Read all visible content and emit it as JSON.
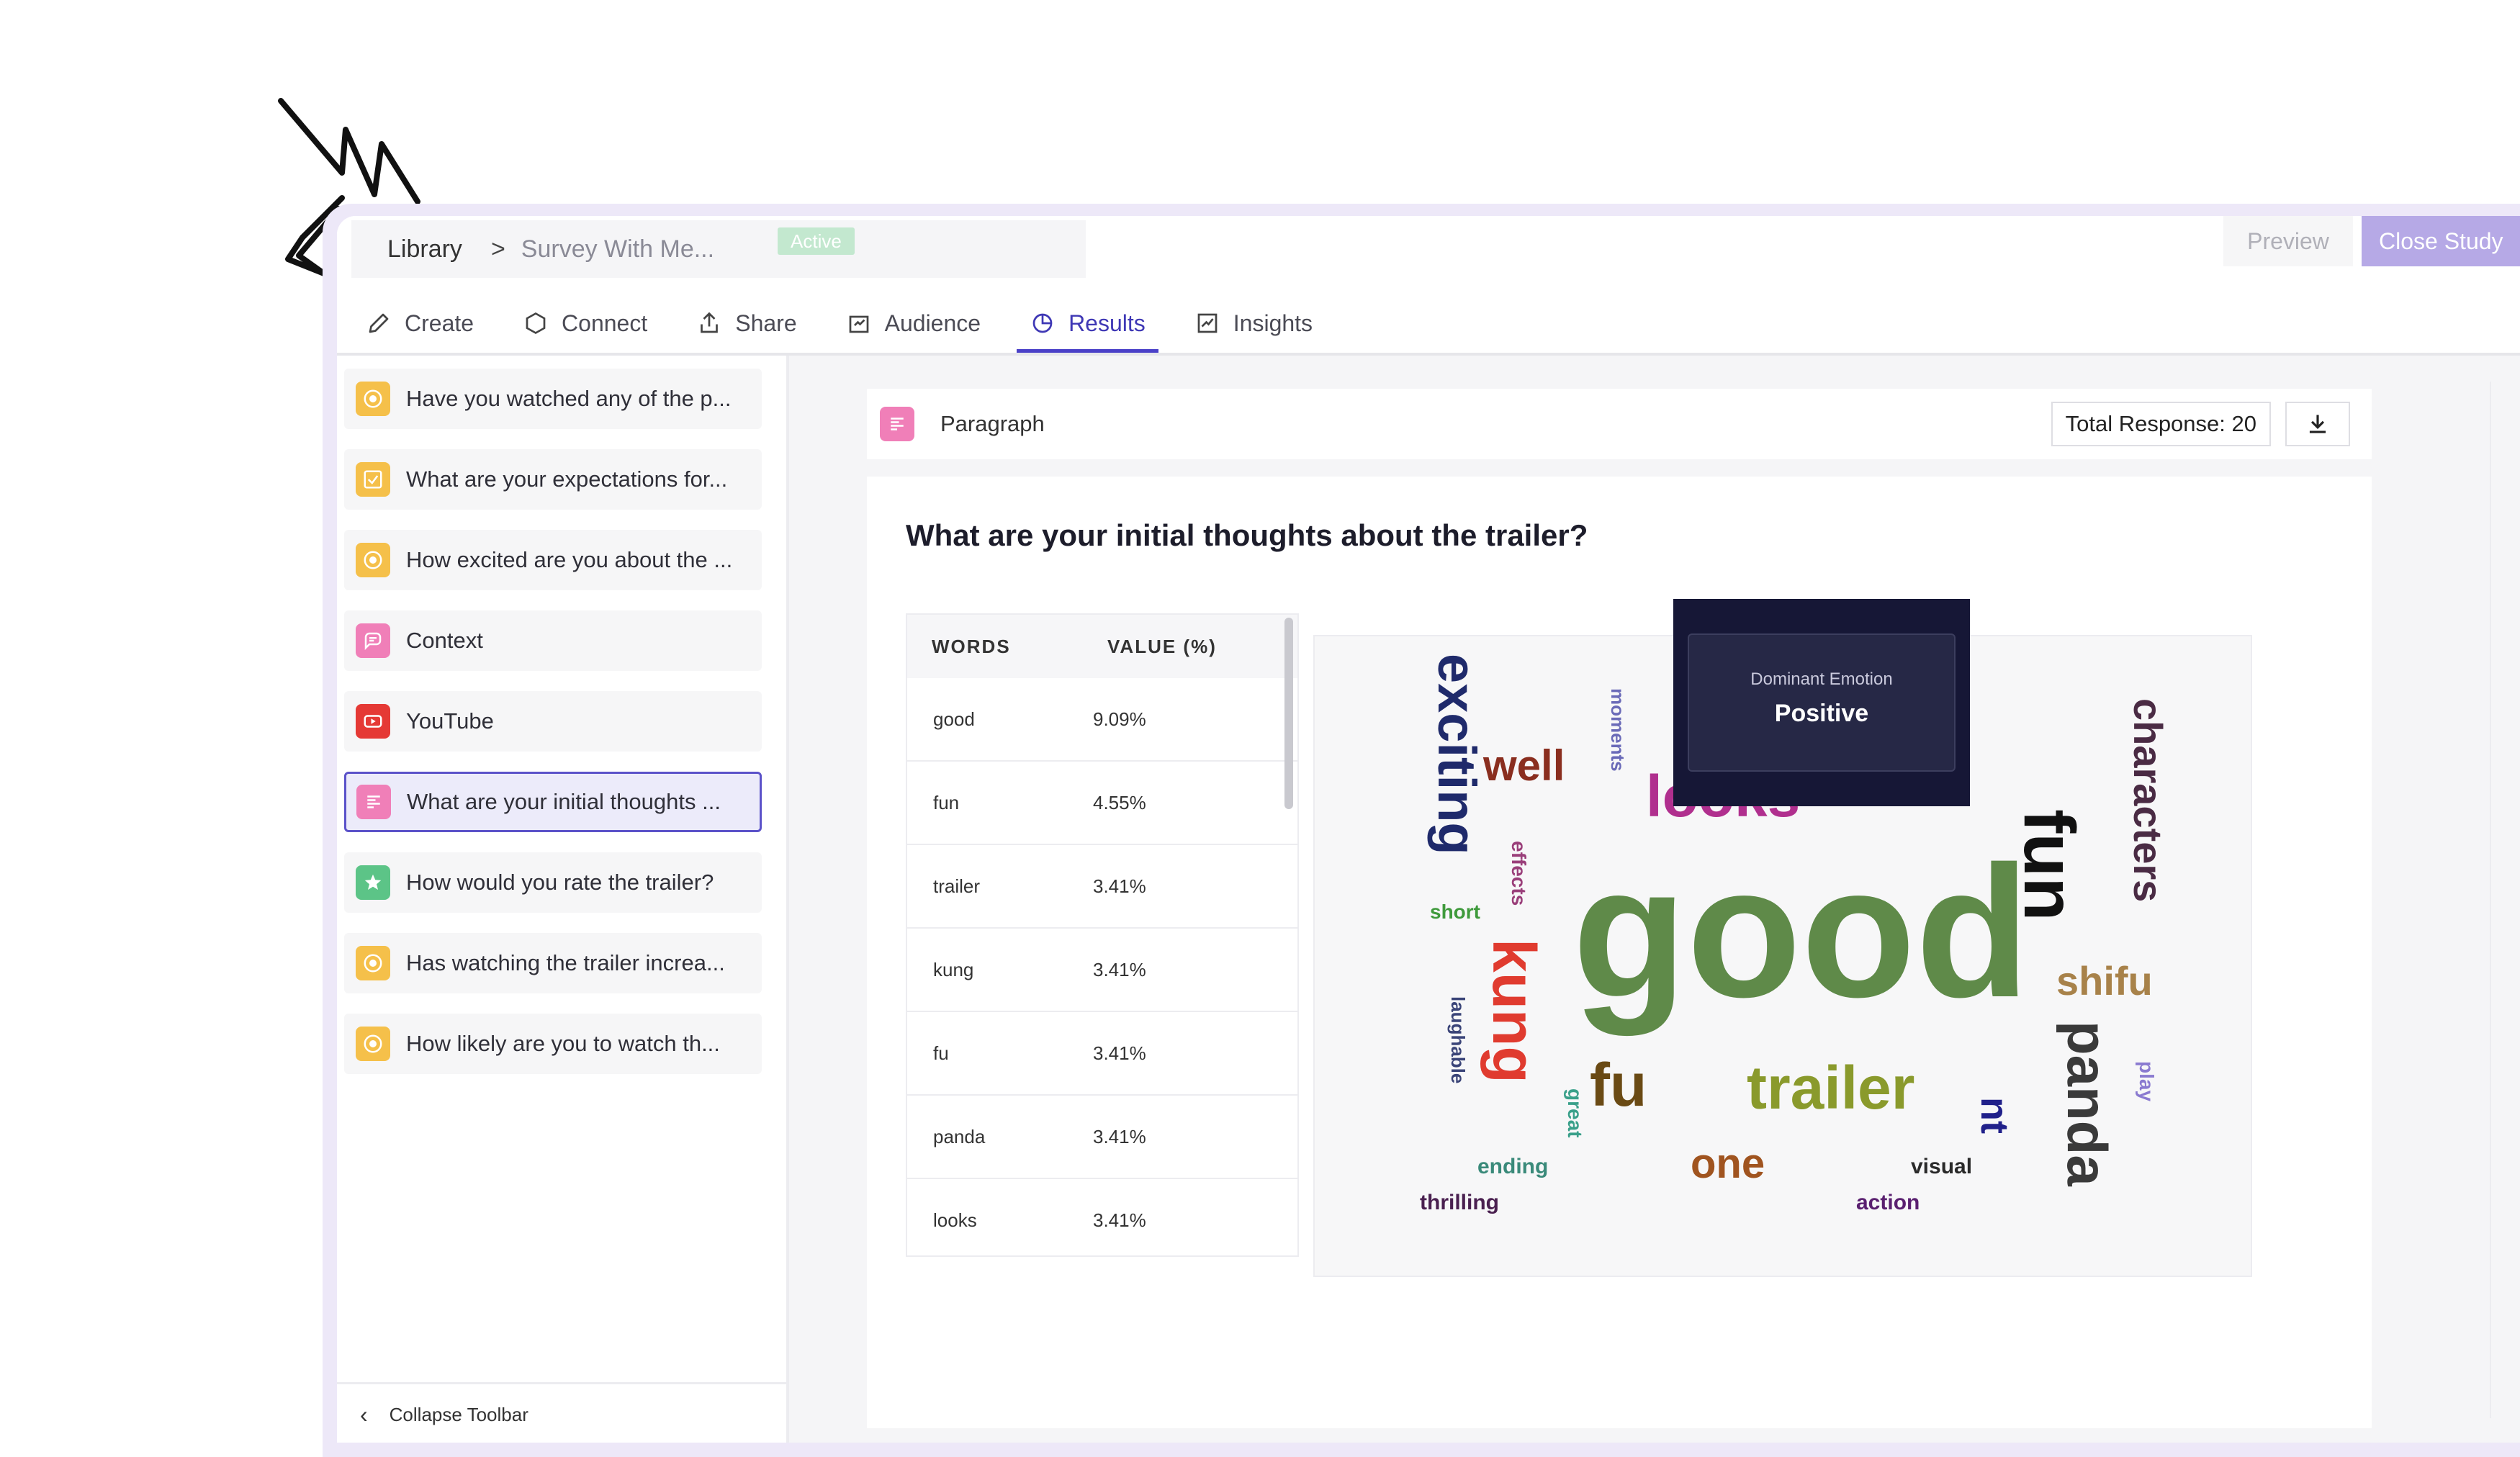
{
  "breadcrumb": {
    "library": "Library",
    "separator": ">",
    "survey": "Survey With Me..."
  },
  "status": "Active",
  "actions": {
    "preview": "Preview",
    "close": "Close Study"
  },
  "tabs": [
    {
      "label": "Create",
      "icon": "pencil-icon"
    },
    {
      "label": "Connect",
      "icon": "hexagon-icon"
    },
    {
      "label": "Share",
      "icon": "upload-icon"
    },
    {
      "label": "Audience",
      "icon": "audience-icon"
    },
    {
      "label": "Results",
      "icon": "pie-chart-icon",
      "active": true
    },
    {
      "label": "Insights",
      "icon": "insights-icon"
    }
  ],
  "sidebar": {
    "items": [
      {
        "label": "Have you watched any of the p...",
        "icon": "radio-icon",
        "color": "#f5c04a"
      },
      {
        "label": "What are your expectations for...",
        "icon": "checkbox-icon",
        "color": "#f5c04a"
      },
      {
        "label": "How excited are you about the ...",
        "icon": "radio-icon",
        "color": "#f5c04a"
      },
      {
        "label": "Context",
        "icon": "message-icon",
        "color": "#f07fb8"
      },
      {
        "label": "YouTube",
        "icon": "youtube-icon",
        "color": "#e53935"
      },
      {
        "label": "What are your initial thoughts ...",
        "icon": "paragraph-icon",
        "color": "#f07fb8",
        "selected": true
      },
      {
        "label": "How would you rate the trailer?",
        "icon": "star-icon",
        "color": "#5cc487"
      },
      {
        "label": "Has watching the trailer increa...",
        "icon": "radio-icon",
        "color": "#f5c04a"
      },
      {
        "label": "How likely are you to watch th...",
        "icon": "radio-icon",
        "color": "#f5c04a"
      }
    ],
    "collapse": "Collapse Toolbar"
  },
  "question_type": "Paragraph",
  "total_response": "Total Response: 20",
  "question_title": "What are your initial thoughts about the trailer?",
  "table": {
    "headers": [
      "WORDS",
      "VALUE (%)"
    ],
    "rows": [
      [
        "good",
        "9.09%"
      ],
      [
        "fun",
        "4.55%"
      ],
      [
        "trailer",
        "3.41%"
      ],
      [
        "kung",
        "3.41%"
      ],
      [
        "fu",
        "3.41%"
      ],
      [
        "panda",
        "3.41%"
      ],
      [
        "looks",
        "3.41%"
      ]
    ]
  },
  "tooltip": {
    "label": "Dominant Emotion",
    "value": "Positive"
  },
  "wordcloud": [
    {
      "text": "good",
      "color": "#5f8a49"
    },
    {
      "text": "exciting",
      "color": "#1f2a6b"
    },
    {
      "text": "well",
      "color": "#8a2e1f"
    },
    {
      "text": "moments",
      "color": "#6a6ab8"
    },
    {
      "text": "looks",
      "color": "#b02f8e"
    },
    {
      "text": "characters",
      "color": "#4a2b44"
    },
    {
      "text": "fun",
      "color": "#111111"
    },
    {
      "text": "effects",
      "color": "#9a3f7a"
    },
    {
      "text": "short",
      "color": "#3f9a3c"
    },
    {
      "text": "kung",
      "color": "#e03b2f"
    },
    {
      "text": "shifu",
      "color": "#a8824a"
    },
    {
      "text": "laughable",
      "color": "#3a4478"
    },
    {
      "text": "fu",
      "color": "#6a4a14"
    },
    {
      "text": "trailer",
      "color": "#8a9a2c"
    },
    {
      "text": "panda",
      "color": "#3a3a3a"
    },
    {
      "text": "play",
      "color": "#8a7ad0"
    },
    {
      "text": "great",
      "color": "#3aa08a"
    },
    {
      "text": "nt",
      "color": "#20208a"
    },
    {
      "text": "ending",
      "color": "#3a8a7a"
    },
    {
      "text": "one",
      "color": "#a0541f"
    },
    {
      "text": "visual",
      "color": "#2a2a2a"
    },
    {
      "text": "thrilling",
      "color": "#4a2050"
    },
    {
      "text": "action",
      "color": "#5a2070"
    }
  ]
}
